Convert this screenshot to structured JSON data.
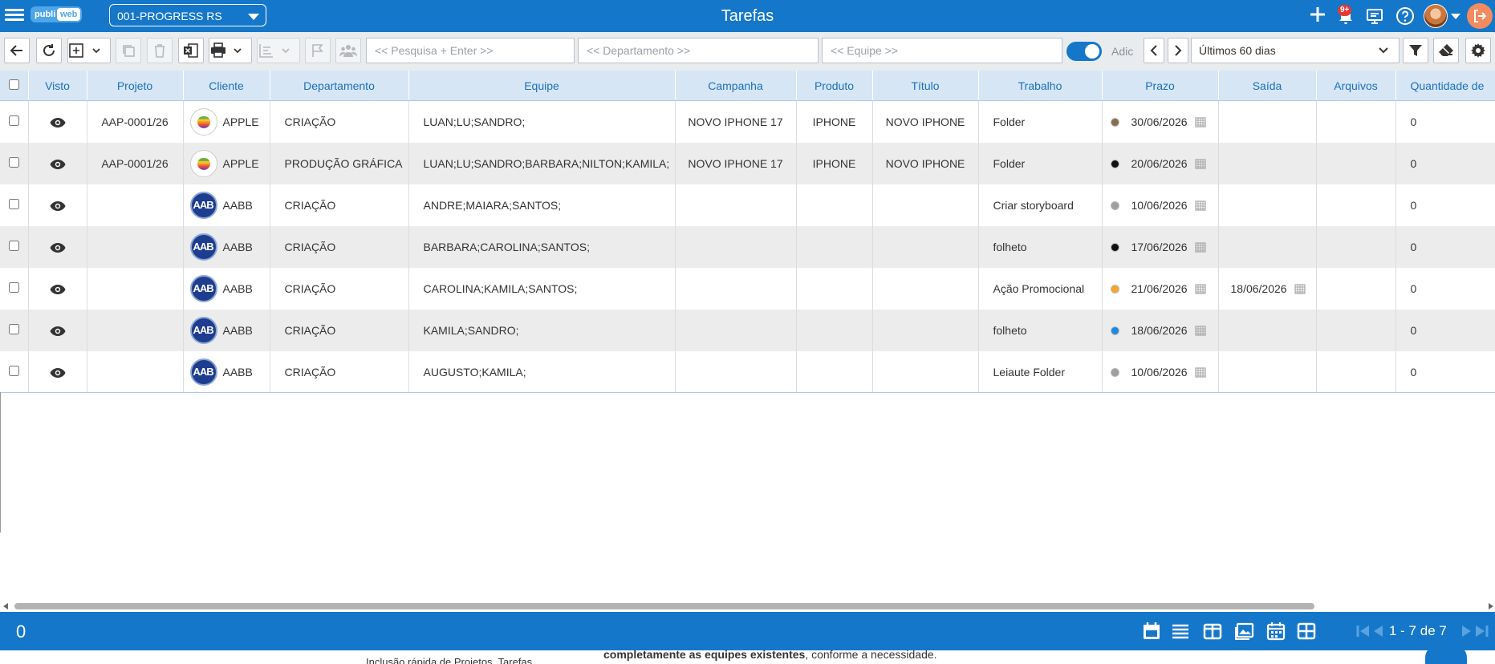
{
  "header": {
    "title": "Tarefas",
    "logo_left": "publi",
    "logo_right": "web",
    "company_select": "001-PROGRESS RS",
    "notification_badge": "9+"
  },
  "toolbar": {
    "search_placeholder": "<< Pesquisa + Enter >>",
    "department_placeholder": "<< Departamento >>",
    "team_placeholder": "<< Equipe >>",
    "toggle_label": "Adic",
    "period": "Últimos 60 dias"
  },
  "table": {
    "columns": [
      "Visto",
      "Projeto",
      "Cliente",
      "Departamento",
      "Equipe",
      "Campanha",
      "Produto",
      "Título",
      "Trabalho",
      "Prazo",
      "Saída",
      "Arquivos",
      "Quantidade de"
    ],
    "rows": [
      {
        "projeto": "AAP-0001/26",
        "cliente": "APPLE",
        "logo": "apple",
        "departamento": "CRIAÇÃO",
        "equipe": "LUAN;LU;SANDRO;",
        "campanha": "NOVO IPHONE 17",
        "produto": "IPHONE",
        "titulo": "NOVO IPHONE",
        "trabalho": "Folder",
        "status": "#8a6d4a",
        "prazo": "30/06/2026",
        "saida": "",
        "arquivos": "",
        "quantidade": "0"
      },
      {
        "projeto": "AAP-0001/26",
        "cliente": "APPLE",
        "logo": "apple",
        "departamento": "PRODUÇÃO GRÁFICA",
        "equipe": "LUAN;LU;SANDRO;BARBARA;NILTON;KAMILA;",
        "campanha": "NOVO IPHONE 17",
        "produto": "IPHONE",
        "titulo": "NOVO IPHONE",
        "trabalho": "Folder",
        "status": "#111111",
        "prazo": "20/06/2026",
        "saida": "",
        "arquivos": "",
        "quantidade": "0"
      },
      {
        "projeto": "",
        "cliente": "AABB",
        "logo": "aabb",
        "departamento": "CRIAÇÃO",
        "equipe": "ANDRE;MAIARA;SANTOS;",
        "campanha": "",
        "produto": "",
        "titulo": "",
        "trabalho": "Criar storyboard",
        "status": "#9e9e9e",
        "prazo": "10/06/2026",
        "saida": "",
        "arquivos": "",
        "quantidade": "0"
      },
      {
        "projeto": "",
        "cliente": "AABB",
        "logo": "aabb",
        "departamento": "CRIAÇÃO",
        "equipe": "BARBARA;CAROLINA;SANTOS;",
        "campanha": "",
        "produto": "",
        "titulo": "",
        "trabalho": "folheto",
        "status": "#111111",
        "prazo": "17/06/2026",
        "saida": "",
        "arquivos": "",
        "quantidade": "0"
      },
      {
        "projeto": "",
        "cliente": "AABB",
        "logo": "aabb",
        "departamento": "CRIAÇÃO",
        "equipe": "CAROLINA;KAMILA;SANTOS;",
        "campanha": "",
        "produto": "",
        "titulo": "",
        "trabalho": "Ação Promocional",
        "status": "#f5a623",
        "prazo": "21/06/2026",
        "saida": "18/06/2026",
        "arquivos": "",
        "quantidade": "0"
      },
      {
        "projeto": "",
        "cliente": "AABB",
        "logo": "aabb",
        "departamento": "CRIAÇÃO",
        "equipe": "KAMILA;SANDRO;",
        "campanha": "",
        "produto": "",
        "titulo": "",
        "trabalho": "folheto",
        "status": "#1e88e5",
        "prazo": "18/06/2026",
        "saida": "",
        "arquivos": "",
        "quantidade": "0"
      },
      {
        "projeto": "",
        "cliente": "AABB",
        "logo": "aabb",
        "departamento": "CRIAÇÃO",
        "equipe": "AUGUSTO;KAMILA;",
        "campanha": "",
        "produto": "",
        "titulo": "",
        "trabalho": "Leiaute Folder",
        "status": "#9e9e9e",
        "prazo": "10/06/2026",
        "saida": "",
        "arquivos": "",
        "quantidade": "0"
      }
    ]
  },
  "logos": {
    "aabb": "AAB"
  },
  "footer": {
    "count": "0",
    "pagination": "1 - 7 de 7"
  },
  "underlay": {
    "bold_text": "completamente as equipes existentes",
    "rest_text": ", conforme a necessidade.",
    "caption": "Inclusão rápida de Projetos, Tarefas"
  },
  "colors": {
    "primary": "#1577c9",
    "header_row": "#d7e6f4",
    "alt_row": "#ececec"
  }
}
